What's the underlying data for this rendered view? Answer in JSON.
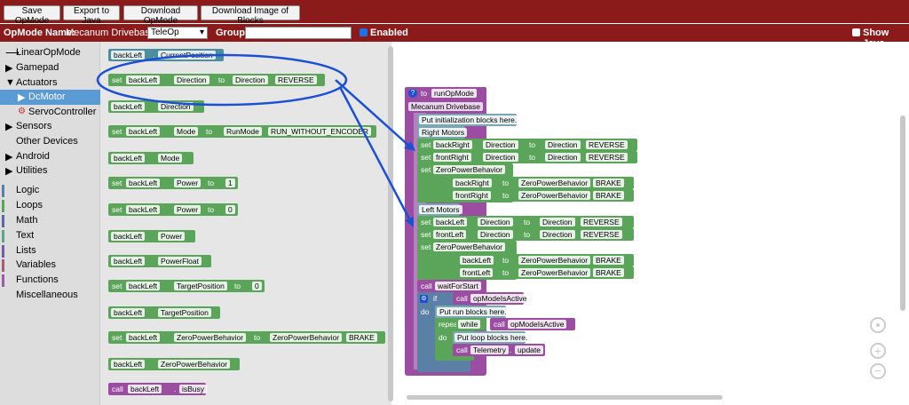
{
  "toolbar": {
    "save_label": "Save OpMode",
    "export_label": "Export to Java",
    "download_label": "Download OpMode",
    "download_image_label": "Download Image of Blocks"
  },
  "info": {
    "opmode_label": "OpMode Name:",
    "opmode_name": "Mecanum Drivebase",
    "mode_selected": "TeleOp",
    "group_label": "Group:",
    "group_value": "",
    "enabled_label": "Enabled",
    "show_java_label": "Show Java"
  },
  "toolbox": {
    "linear": "LinearOpMode",
    "gamepad": "Gamepad",
    "actuators": "Actuators",
    "dcmotor": "DcMotor",
    "servo": "ServoController",
    "sensors": "Sensors",
    "other": "Other Devices",
    "android": "Android",
    "utilities": "Utilities",
    "logic": "Logic",
    "loops": "Loops",
    "math": "Math",
    "text": "Text",
    "lists": "Lists",
    "variables": "Variables",
    "functions": "Functions",
    "misc": "Miscellaneous"
  },
  "flyout": {
    "backLeft": "backLeft",
    "set": "set",
    "to": "to",
    "call": "call",
    "current_position": "CurrentPosition",
    "direction": "Direction",
    "reverse": "REVERSE",
    "mode": "Mode",
    "runmode": "RunMode",
    "run_without_encoder": "RUN_WITHOUT_ENCODER",
    "power": "Power",
    "power_one": "1",
    "power_zero": "0",
    "power_float": "PowerFloat",
    "target_position": "TargetPosition",
    "target_zero": "0",
    "zpb": "ZeroPowerBehavior",
    "brake": "BRAKE",
    "is_busy": "isBusy"
  },
  "workspace": {
    "func_to": "to",
    "func_name": "runOpMode",
    "comment": "Mecanum Drivebase",
    "init_here": "Put initialization blocks here.",
    "right_motors": "Right Motors",
    "left_motors": "Left Motors",
    "backRight": "backRight",
    "frontRight": "frontRight",
    "backLeft": "backLeft",
    "frontLeft": "frontLeft",
    "wait_for_start": "waitForStart",
    "if": "if",
    "do": "do",
    "op_mode_is_active": "opModeIsActive",
    "run_here": "Put run blocks here.",
    "repeat_while": "repeat",
    "while": "while",
    "loop_here": "Put loop blocks here.",
    "telemetry": "Telemetry",
    "update": "update"
  },
  "colors": {
    "header_bg": "#8b1a1a",
    "motor_green": "#5ba55b",
    "highlight_blue": "#1a4fd6",
    "purple": "#9b4ea1"
  }
}
